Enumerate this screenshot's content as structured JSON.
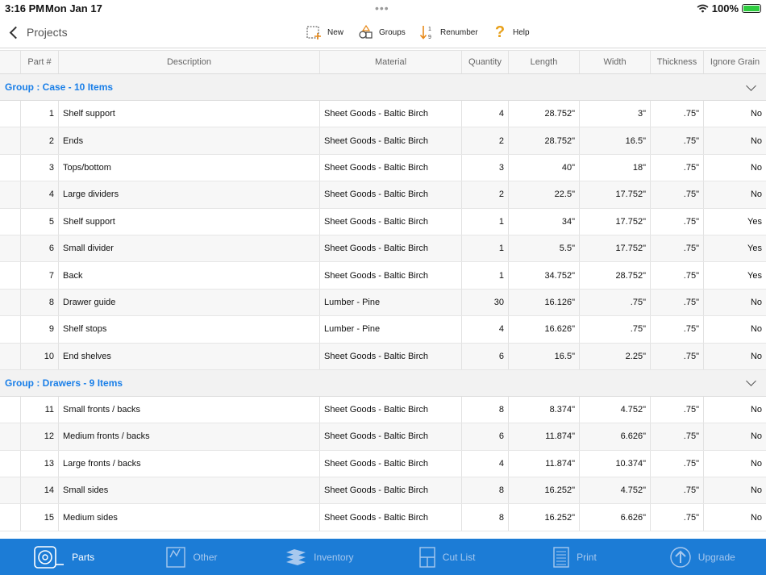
{
  "status": {
    "time": "3:16 PM",
    "date": "Mon Jan 17",
    "battery": "100%"
  },
  "nav": {
    "back_label": "Projects"
  },
  "toolbar": {
    "new": "New",
    "groups": "Groups",
    "renumber": "Renumber",
    "help": "Help"
  },
  "table": {
    "headers": [
      "Part #",
      "Description",
      "Material",
      "Quantity",
      "Length",
      "Width",
      "Thickness",
      "Ignore Grain"
    ],
    "groups": [
      {
        "label": "Group : Case - 10 Items",
        "rows": [
          {
            "part": "1",
            "description": "Shelf support",
            "material": "Sheet Goods - Baltic Birch",
            "quantity": "4",
            "length": "28.752\"",
            "width": "3\"",
            "thickness": ".75\"",
            "ignore_grain": "No"
          },
          {
            "part": "2",
            "description": "Ends",
            "material": "Sheet Goods - Baltic Birch",
            "quantity": "2",
            "length": "28.752\"",
            "width": "16.5\"",
            "thickness": ".75\"",
            "ignore_grain": "No"
          },
          {
            "part": "3",
            "description": "Tops/bottom",
            "material": "Sheet Goods - Baltic Birch",
            "quantity": "3",
            "length": "40\"",
            "width": "18\"",
            "thickness": ".75\"",
            "ignore_grain": "No"
          },
          {
            "part": "4",
            "description": "Large dividers",
            "material": "Sheet Goods - Baltic Birch",
            "quantity": "2",
            "length": "22.5\"",
            "width": "17.752\"",
            "thickness": ".75\"",
            "ignore_grain": "No"
          },
          {
            "part": "5",
            "description": "Shelf support",
            "material": "Sheet Goods - Baltic Birch",
            "quantity": "1",
            "length": "34\"",
            "width": "17.752\"",
            "thickness": ".75\"",
            "ignore_grain": "Yes"
          },
          {
            "part": "6",
            "description": "Small divider",
            "material": "Sheet Goods - Baltic Birch",
            "quantity": "1",
            "length": "5.5\"",
            "width": "17.752\"",
            "thickness": ".75\"",
            "ignore_grain": "Yes"
          },
          {
            "part": "7",
            "description": "Back",
            "material": "Sheet Goods - Baltic Birch",
            "quantity": "1",
            "length": "34.752\"",
            "width": "28.752\"",
            "thickness": ".75\"",
            "ignore_grain": "Yes"
          },
          {
            "part": "8",
            "description": "Drawer guide",
            "material": "Lumber - Pine",
            "quantity": "30",
            "length": "16.126\"",
            "width": ".75\"",
            "thickness": ".75\"",
            "ignore_grain": "No"
          },
          {
            "part": "9",
            "description": "Shelf stops",
            "material": "Lumber - Pine",
            "quantity": "4",
            "length": "16.626\"",
            "width": ".75\"",
            "thickness": ".75\"",
            "ignore_grain": "No"
          },
          {
            "part": "10",
            "description": "End shelves",
            "material": "Sheet Goods - Baltic Birch",
            "quantity": "6",
            "length": "16.5\"",
            "width": "2.25\"",
            "thickness": ".75\"",
            "ignore_grain": "No"
          }
        ]
      },
      {
        "label": "Group : Drawers - 9 Items",
        "rows": [
          {
            "part": "11",
            "description": "Small fronts / backs",
            "material": "Sheet Goods - Baltic Birch",
            "quantity": "8",
            "length": "8.374\"",
            "width": "4.752\"",
            "thickness": ".75\"",
            "ignore_grain": "No"
          },
          {
            "part": "12",
            "description": "Medium fronts / backs",
            "material": "Sheet Goods - Baltic Birch",
            "quantity": "6",
            "length": "11.874\"",
            "width": "6.626\"",
            "thickness": ".75\"",
            "ignore_grain": "No"
          },
          {
            "part": "13",
            "description": "Large fronts / backs",
            "material": "Sheet Goods - Baltic Birch",
            "quantity": "4",
            "length": "11.874\"",
            "width": "10.374\"",
            "thickness": ".75\"",
            "ignore_grain": "No"
          },
          {
            "part": "14",
            "description": "Small sides",
            "material": "Sheet Goods - Baltic Birch",
            "quantity": "8",
            "length": "16.252\"",
            "width": "4.752\"",
            "thickness": ".75\"",
            "ignore_grain": "No"
          },
          {
            "part": "15",
            "description": "Medium sides",
            "material": "Sheet Goods - Baltic Birch",
            "quantity": "8",
            "length": "16.252\"",
            "width": "6.626\"",
            "thickness": ".75\"",
            "ignore_grain": "No"
          }
        ]
      }
    ]
  },
  "tabs": [
    {
      "label": "Parts",
      "icon": "tape-measure-icon",
      "active": true
    },
    {
      "label": "Other",
      "icon": "other-icon",
      "active": false
    },
    {
      "label": "Inventory",
      "icon": "inventory-stack-icon",
      "active": false
    },
    {
      "label": "Cut List",
      "icon": "cut-list-icon",
      "active": false
    },
    {
      "label": "Print",
      "icon": "print-icon",
      "active": false
    },
    {
      "label": "Upgrade",
      "icon": "upgrade-arrow-icon",
      "active": false
    }
  ],
  "colors": {
    "accent": "#1a7fe8",
    "tab_bar": "#1c7cd6"
  }
}
